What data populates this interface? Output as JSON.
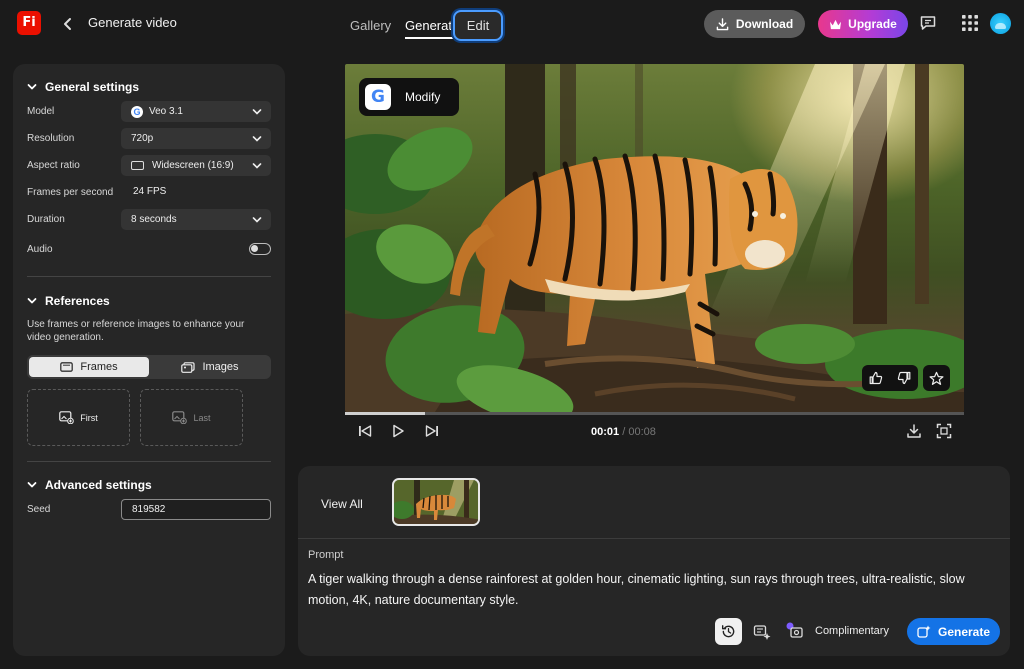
{
  "app": {
    "logo_text": "Fi",
    "page_title": "Generate video"
  },
  "nav": {
    "tabs": [
      {
        "label": "Gallery"
      },
      {
        "label": "Generate"
      },
      {
        "label": "Edit"
      }
    ]
  },
  "header": {
    "download_label": "Download",
    "upgrade_label": "Upgrade"
  },
  "general_settings": {
    "title": "General settings",
    "model": {
      "label": "Model",
      "value": "Veo 3.1"
    },
    "resolution": {
      "label": "Resolution",
      "value": "720p"
    },
    "aspect_ratio": {
      "label": "Aspect ratio",
      "value": "Widescreen (16:9)"
    },
    "fps": {
      "label": "Frames per second",
      "value": "24 FPS"
    },
    "duration": {
      "label": "Duration",
      "value": "8 seconds"
    },
    "audio": {
      "label": "Audio",
      "enabled": false
    }
  },
  "references": {
    "title": "References",
    "description": "Use frames or reference images to enhance your video generation.",
    "tabs": {
      "frames": "Frames",
      "images": "Images"
    },
    "slots": {
      "first": "First",
      "last": "Last"
    }
  },
  "advanced_settings": {
    "title": "Advanced settings",
    "seed": {
      "label": "Seed",
      "value": "819582"
    }
  },
  "player": {
    "modify_label": "Modify",
    "current_time": "00:01",
    "separator": "/",
    "total_time": "00:08",
    "progress_fraction": 0.13
  },
  "results": {
    "view_all_label": "View All"
  },
  "prompt": {
    "label": "Prompt",
    "text": "A tiger walking through a dense rainforest at golden hour, cinematic lighting, sun rays through trees, ultra-realistic, slow motion, 4K, nature documentary style."
  },
  "footer": {
    "credit_label": "Complimentary",
    "generate_label": "Generate"
  },
  "colors": {
    "accent": "#1473e6",
    "focus_ring": "#4b9cff",
    "brand": "#eb1000"
  }
}
